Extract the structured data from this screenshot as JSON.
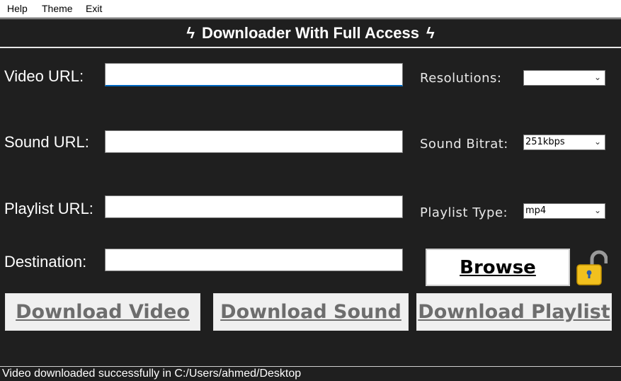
{
  "menu": {
    "help": "Help",
    "theme": "Theme",
    "exit": "Exit"
  },
  "header": {
    "title": "Downloader With Full Access",
    "bolt": "ϟ"
  },
  "form": {
    "video_url": {
      "label": "Video URL:",
      "value": ""
    },
    "sound_url": {
      "label": "Sound URL:",
      "value": ""
    },
    "playlist_url": {
      "label": "Playlist URL:",
      "value": ""
    },
    "destination": {
      "label": "Destination:",
      "value": ""
    }
  },
  "options": {
    "resolutions": {
      "label": "Resolutions:",
      "value": ""
    },
    "sound_bitrate": {
      "label": "Sound Bitrat:",
      "value": "251kbps"
    },
    "playlist_type": {
      "label": "Playlist Type:",
      "value": "mp4"
    }
  },
  "buttons": {
    "browse": "Browse",
    "download_video": "Download Video",
    "download_sound": "Download Sound",
    "download_playlist": "Download Playlist"
  },
  "icons": {
    "lock": "unlocked-padlock-icon",
    "chevron": "chevron-down-icon"
  },
  "status": {
    "text": "Video downloaded successfully in C:/Users/ahmed/Desktop"
  },
  "colors": {
    "background": "#1f1f1f",
    "lock_body": "#f2c01e",
    "focus_accent": "#0067c0"
  }
}
